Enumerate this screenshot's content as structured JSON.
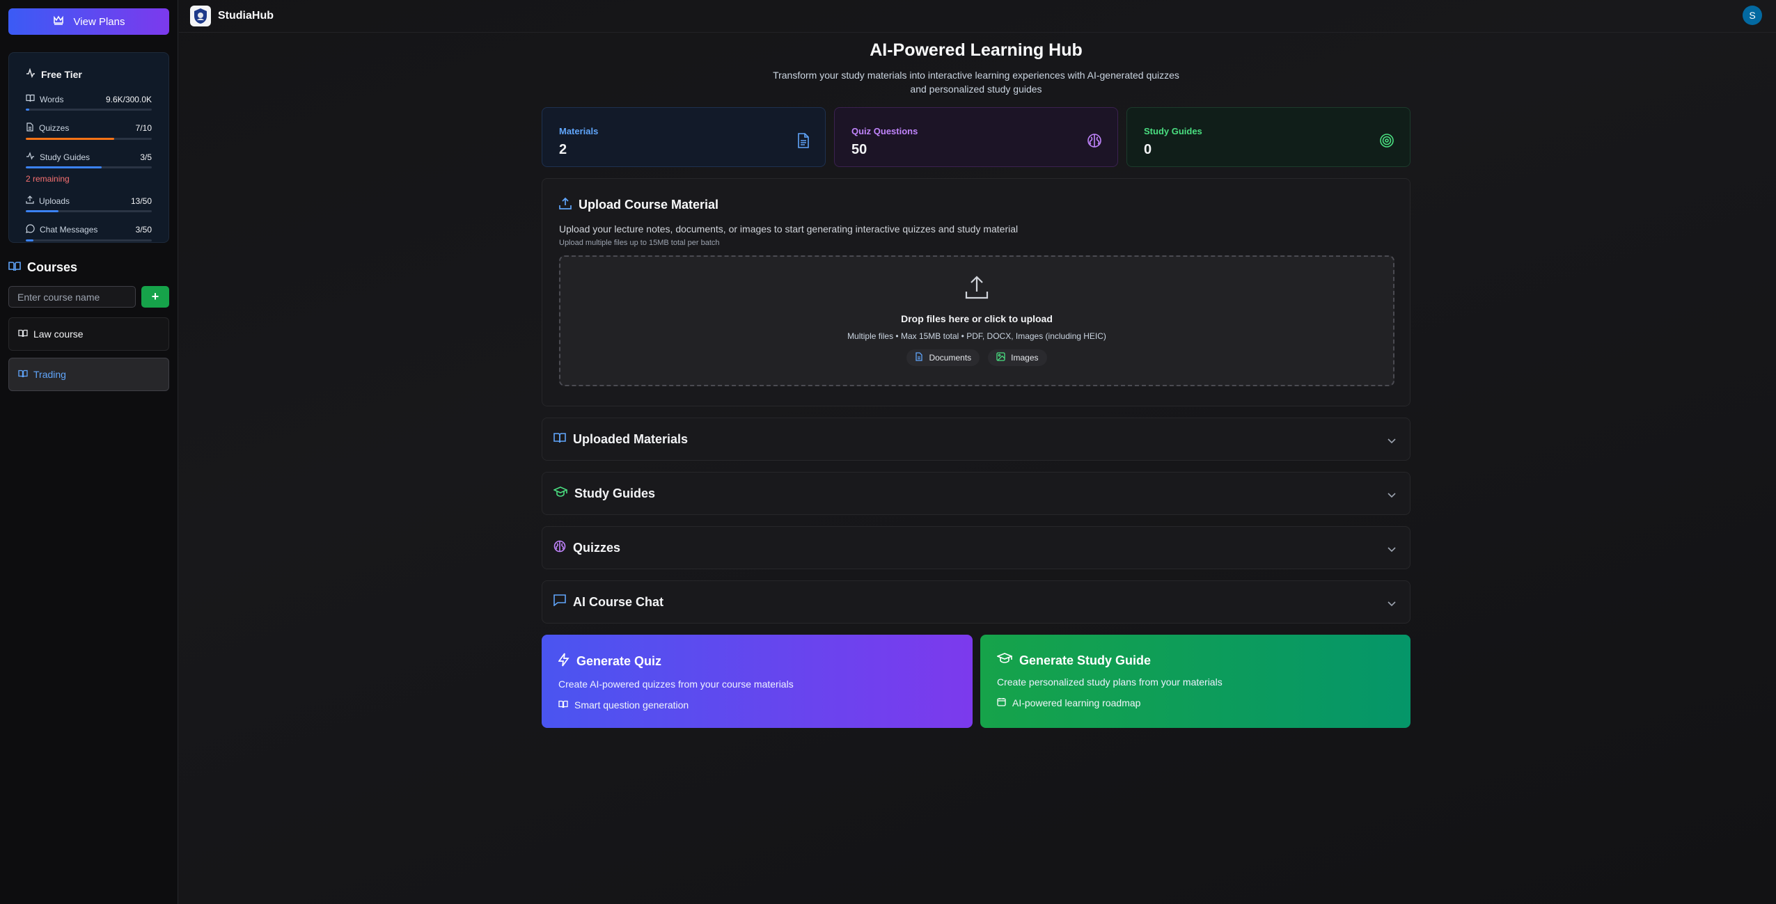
{
  "sidebar": {
    "view_plans_label": "View Plans",
    "tier": {
      "title": "Free Tier",
      "usage": [
        {
          "label": "Words",
          "value": "9.6K/300.0K",
          "percent": 3,
          "color": "#3b82f6",
          "icon": "book-icon"
        },
        {
          "label": "Quizzes",
          "value": "7/10",
          "percent": 70,
          "color": "#f97316",
          "icon": "document-icon"
        },
        {
          "label": "Study Guides",
          "value": "3/5",
          "percent": 60,
          "color": "#3b82f6",
          "icon": "activity-icon"
        },
        {
          "label": "Uploads",
          "value": "13/50",
          "percent": 26,
          "color": "#3b82f6",
          "icon": "upload-icon"
        },
        {
          "label": "Chat Messages",
          "value": "3/50",
          "percent": 6,
          "color": "#3b82f6",
          "icon": "chat-icon"
        }
      ],
      "remaining_note": "2 remaining"
    },
    "courses_title": "Courses",
    "course_input_placeholder": "Enter course name",
    "add_label": "+",
    "courses": [
      {
        "name": "Law course",
        "active": false
      },
      {
        "name": "Trading",
        "active": true
      }
    ]
  },
  "header": {
    "brand": "StudiaHub",
    "avatar_initial": "S"
  },
  "hero": {
    "title": "AI-Powered Learning Hub",
    "subtitle": "Transform your study materials into interactive learning experiences with AI-generated quizzes and personalized study guides"
  },
  "stats": {
    "materials": {
      "label": "Materials",
      "value": "2"
    },
    "quiz_questions": {
      "label": "Quiz Questions",
      "value": "50"
    },
    "study_guides": {
      "label": "Study Guides",
      "value": "0"
    }
  },
  "upload": {
    "title": "Upload Course Material",
    "description": "Upload your lecture notes, documents, or images to start generating interactive quizzes and study material",
    "note": "Upload multiple files up to 15MB total per batch",
    "drop_title": "Drop files here or click to upload",
    "drop_sub": "Multiple files • Max 15MB total • PDF, DOCX, Images (including HEIC)",
    "chips": [
      "Documents",
      "Images"
    ]
  },
  "sections": {
    "materials": "Uploaded Materials",
    "guides": "Study Guides",
    "quizzes": "Quizzes",
    "chat": "AI Course Chat"
  },
  "actions": {
    "quiz": {
      "title": "Generate Quiz",
      "desc": "Create AI-powered quizzes from your course materials",
      "feature": "Smart question generation"
    },
    "guide": {
      "title": "Generate Study Guide",
      "desc": "Create personalized study plans from your materials",
      "feature": "AI-powered learning roadmap"
    }
  },
  "colors": {
    "accent_blue": "#3b82f6",
    "accent_purple": "#a855f7",
    "accent_green": "#22c55e"
  }
}
